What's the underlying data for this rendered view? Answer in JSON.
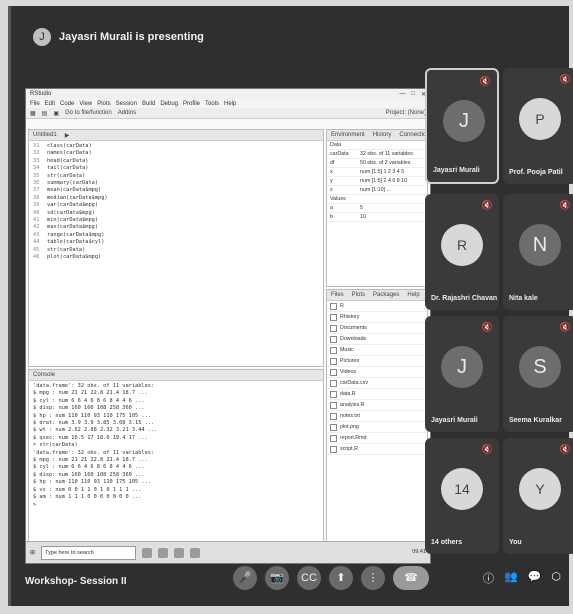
{
  "presenter": {
    "badge": "J",
    "text": "Jayasri Murali is presenting"
  },
  "rstudio": {
    "title": "RStudio",
    "menus": [
      "File",
      "Edit",
      "Code",
      "View",
      "Plots",
      "Session",
      "Build",
      "Debug",
      "Profile",
      "Tools",
      "Help"
    ],
    "toolbar": [
      "Go to file/function",
      "Addins"
    ],
    "project": "Project: (None)",
    "source_tab": "Untitled1",
    "code_lines": [
      {
        "n": "31",
        "t": "class(carData)"
      },
      {
        "n": "32",
        "t": "names(carData)"
      },
      {
        "n": "33",
        "t": "head(carData)"
      },
      {
        "n": "34",
        "t": "tail(carData)"
      },
      {
        "n": "35",
        "t": "str(carData)"
      },
      {
        "n": "36",
        "t": "summary(carData)"
      },
      {
        "n": "37",
        "t": "mean(carData$mpg)"
      },
      {
        "n": "38",
        "t": "median(carData$mpg)"
      },
      {
        "n": "39",
        "t": "var(carData$mpg)"
      },
      {
        "n": "40",
        "t": "sd(carData$mpg)"
      },
      {
        "n": "41",
        "t": "min(carData$mpg)"
      },
      {
        "n": "42",
        "t": "max(carData$mpg)"
      },
      {
        "n": "43",
        "t": "range(carData$mpg)"
      },
      {
        "n": "44",
        "t": "table(carData$cyl)"
      },
      {
        "n": "45",
        "t": "str(carData)"
      },
      {
        "n": "46",
        "t": "plot(carData$mpg)"
      }
    ],
    "console_tab": "Console",
    "console_lines": [
      "'data.frame':   32 obs. of 11 variables:",
      " $ mpg : num  21 21 22.8 21.4 18.7 ...",
      " $ cyl : num  6 6 4 6 8 6 8 4 4 6 ...",
      " $ disp: num  160 160 108 258 360 ...",
      " $ hp  : num  110 110 93 110 175 105 ...",
      " $ drat: num  3.9 3.9 3.85 3.08 3.15 ...",
      " $ wt  : num  2.62 2.88 2.32 3.21 3.44 ...",
      " $ qsec: num  16.5 17 18.6 19.4 17 ...",
      "> str(carData)",
      "'data.frame':   32 obs. of 11 variables:",
      " $ mpg : num  21 21 22.8 21.4 18.7 ...",
      " $ cyl : num  6 6 4 6 8 6 8 4 4 6 ...",
      " $ disp: num  160 160 108 258 360 ...",
      " $ hp  : num  110 110 93 110 175 105 ...",
      " $ vs  : num  0 0 1 1 0 1 0 1 1 1 ...",
      " $ am  : num  1 1 1 0 0 0 0 0 0 0 ...",
      "> "
    ],
    "env_tabs": [
      "Environment",
      "History",
      "Connections",
      "Tutorial"
    ],
    "env_rows": [
      {
        "k": "Data",
        "v": ""
      },
      {
        "k": "carData",
        "v": "32 obs. of 11 variables"
      },
      {
        "k": "df",
        "v": "50 obs. of 2 variables"
      },
      {
        "k": "x",
        "v": "num [1:5] 1 2 3 4 5"
      },
      {
        "k": "y",
        "v": "num [1:5] 2 4 6 8 10"
      },
      {
        "k": "z",
        "v": "num [1:10] ..."
      },
      {
        "k": "Values",
        "v": ""
      },
      {
        "k": "a",
        "v": "5"
      },
      {
        "k": "b",
        "v": "10"
      }
    ],
    "files_tabs": [
      "Files",
      "Plots",
      "Packages",
      "Help",
      "Viewer"
    ],
    "files_rows": [
      "R",
      "Rhistory",
      "Documents",
      "Downloads",
      "Music",
      "Pictures",
      "Videos",
      "carData.csv",
      "data.R",
      "analysis.R",
      "notes.txt",
      "plot.png",
      "report.Rmd",
      "script.R"
    ],
    "taskbar_search": "Type here to search",
    "clock": "09:41"
  },
  "participants": [
    {
      "name": "Jayasri Murali",
      "initial": "J",
      "type": "avatar",
      "active": true
    },
    {
      "name": "Prof. Pooja Patil",
      "initial": "P",
      "type": "photo",
      "active": false
    },
    {
      "name": "Dr. Rajashri Chavan",
      "initial": "R",
      "type": "photo",
      "active": false
    },
    {
      "name": "Nita kale",
      "initial": "N",
      "type": "avatar",
      "active": false
    },
    {
      "name": "Jayasri Murali",
      "initial": "J",
      "type": "avatar",
      "active": false
    },
    {
      "name": "Seema Kuralkar",
      "initial": "S",
      "type": "avatar",
      "active": false
    },
    {
      "name": "14 others",
      "initial": "14",
      "type": "photo",
      "active": false
    },
    {
      "name": "You",
      "initial": "Y",
      "type": "photo",
      "active": false
    }
  ],
  "meeting": {
    "title": "Workshop- Session II"
  },
  "controls": [
    {
      "name": "mic-button",
      "glyph": "🎤"
    },
    {
      "name": "camera-button",
      "glyph": "📷"
    },
    {
      "name": "captions-button",
      "glyph": "CC"
    },
    {
      "name": "present-button",
      "glyph": "⬆"
    },
    {
      "name": "more-options-button",
      "glyph": "⋮"
    }
  ],
  "end_call_glyph": "☎",
  "side_controls": [
    {
      "name": "info-icon",
      "glyph": "ⓘ"
    },
    {
      "name": "people-icon",
      "glyph": "👥"
    },
    {
      "name": "chat-icon",
      "glyph": "💬"
    },
    {
      "name": "activities-icon",
      "glyph": "⬡"
    },
    {
      "name": "host-controls-icon",
      "glyph": "🔒"
    }
  ]
}
